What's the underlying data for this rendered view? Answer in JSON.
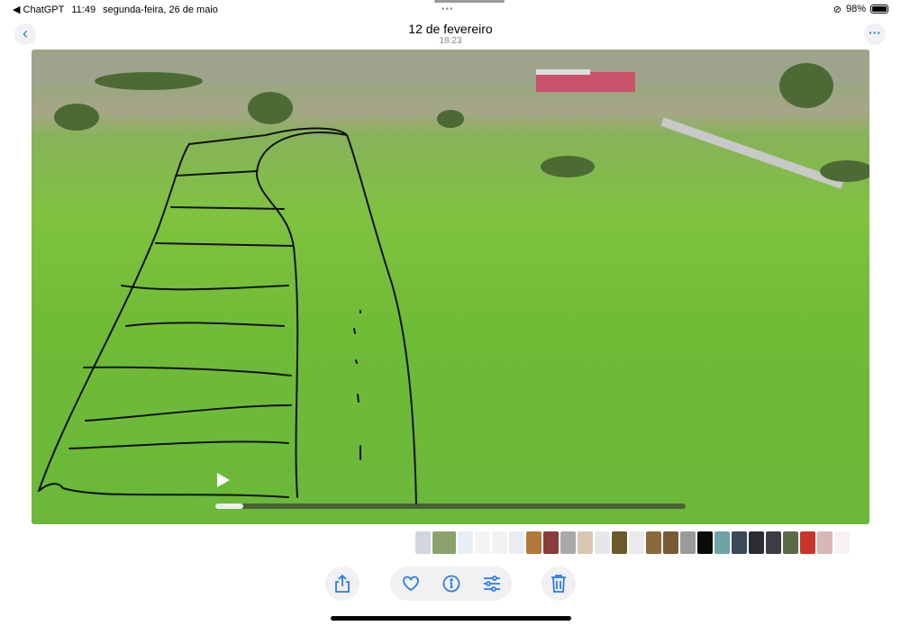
{
  "status_bar": {
    "back_app": "◀ ChatGPT",
    "time": "11:49",
    "date": "segunda-feira, 26 de maio",
    "battery": "98%",
    "battery_level": 0.98
  },
  "header": {
    "title": "12 de fevereiro",
    "subtitle": "18:23"
  },
  "video": {
    "progress": 0.06
  },
  "thumbnails": [
    "#cfd6de",
    "#8aa36c",
    "#e8eef6",
    "#f4f4f4",
    "#f2f2f2",
    "#e9ecf3",
    "#b07a3a",
    "#8a3b3b",
    "#a9a9a9",
    "#d9c7b0",
    "#e5e8ea",
    "#6b5a2c",
    "#eaeaea",
    "#8b6a3a",
    "#7a5a35",
    "#9a9a9a",
    "#0a0a0a",
    "#6fa3a5",
    "#3a4a5a",
    "#2c2c33",
    "#3c3c44",
    "#5a6a4a",
    "#c9352b",
    "#d9b7b7",
    "#f3e5e8"
  ],
  "colors": {
    "accent": "#2a7ce8"
  }
}
